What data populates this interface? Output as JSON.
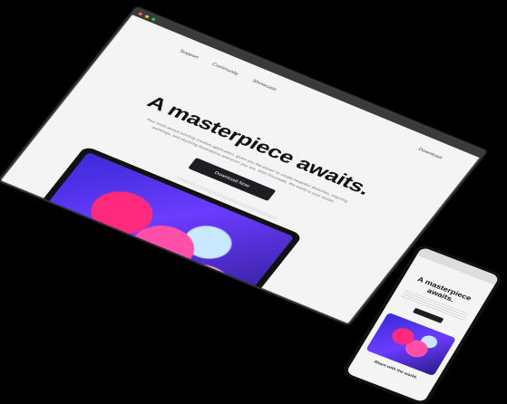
{
  "desktop": {
    "nav": {
      "items": [
        "Support",
        "Community",
        "Showcase"
      ],
      "right_link": "Download"
    },
    "hero": {
      "title": "A masterpiece awaits.",
      "subtitle": "Your multi-award winning creative application, gives you the power to create beautiful sketches, inspiring paintings, and stunning illustrations wherever you are. With Procreate, the world is your studio.",
      "cta_label": "Download Now"
    }
  },
  "phone": {
    "hero": {
      "title": "A masterpiece awaits."
    },
    "caption": "Share with the world."
  },
  "colors": {
    "background": "#000000",
    "page": "#f4f4f4",
    "cta": "#1d1d22",
    "accent_pink": "#ff2a7d",
    "accent_purple": "#6b3cff"
  }
}
